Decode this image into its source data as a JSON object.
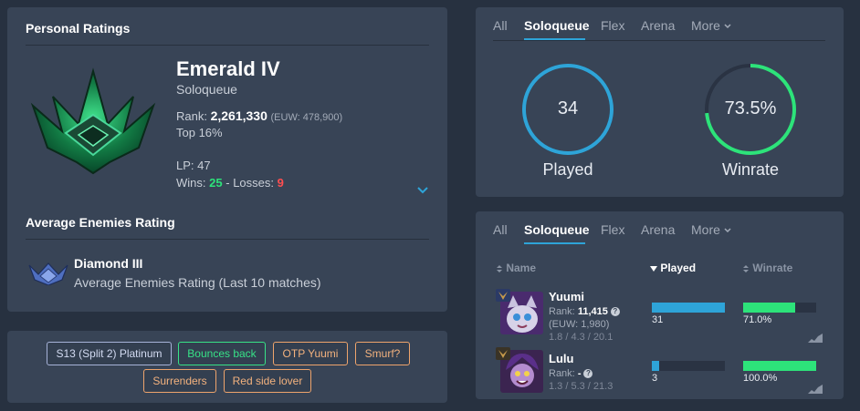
{
  "ratings": {
    "title": "Personal Ratings",
    "rank_name": "Emerald IV",
    "queue": "Soloqueue",
    "rank_label": "Rank:",
    "rank_value": "2,261,330",
    "rank_region": "(EUW: 478,900)",
    "top_percent": "Top 16%",
    "lp": "LP: 47",
    "wins_label": "Wins:",
    "wins": "25",
    "sep": "-",
    "losses_label": "Losses:",
    "losses": "9",
    "expand_icon": "chevron-down-icon",
    "avg_title": "Average Enemies Rating",
    "avg_rank": "Diamond III",
    "avg_desc": "Average Enemies Rating (Last 10 matches)"
  },
  "tags": [
    {
      "label": "S13 (Split 2) Platinum",
      "color": "blue"
    },
    {
      "label": "Bounces back",
      "color": "green"
    },
    {
      "label": "OTP Yuumi",
      "color": "orange"
    },
    {
      "label": "Smurf?",
      "color": "orange"
    },
    {
      "label": "Surrenders",
      "color": "orange"
    },
    {
      "label": "Red side lover",
      "color": "orange"
    }
  ],
  "stats": {
    "tabs": [
      "All",
      "Soloqueue",
      "Flex",
      "Arena",
      "More"
    ],
    "active_tab": "Soloqueue",
    "played_value": "34",
    "played_label": "Played",
    "played_fraction": 1.0,
    "winrate_value": "73.5%",
    "winrate_label": "Winrate",
    "winrate_fraction": 0.735
  },
  "champions": {
    "tabs": [
      "All",
      "Soloqueue",
      "Flex",
      "Arena",
      "More"
    ],
    "active_tab": "Soloqueue",
    "col_name": "Name",
    "col_played": "Played",
    "col_winrate": "Winrate",
    "rows": [
      {
        "name": "Yuumi",
        "rank_label": "Rank:",
        "rank": "11,415",
        "euw": "(EUW: 1,980)",
        "kda": "1.8 / 4.3 / 20.1",
        "played": "31",
        "played_fraction": 1.0,
        "winrate": "71.0%",
        "winrate_fraction": 0.71
      },
      {
        "name": "Lulu",
        "rank_label": "Rank:",
        "rank": "-",
        "euw": "",
        "kda": "1.3 / 5.3 / 21.3",
        "played": "3",
        "played_fraction": 0.097,
        "winrate": "100.0%",
        "winrate_fraction": 1.0
      }
    ]
  },
  "colors": {
    "accent_blue": "#2ea4d8",
    "win_green": "#2de37a",
    "loss_red": "#ff4e50",
    "panel": "#384456",
    "background": "#273140"
  }
}
